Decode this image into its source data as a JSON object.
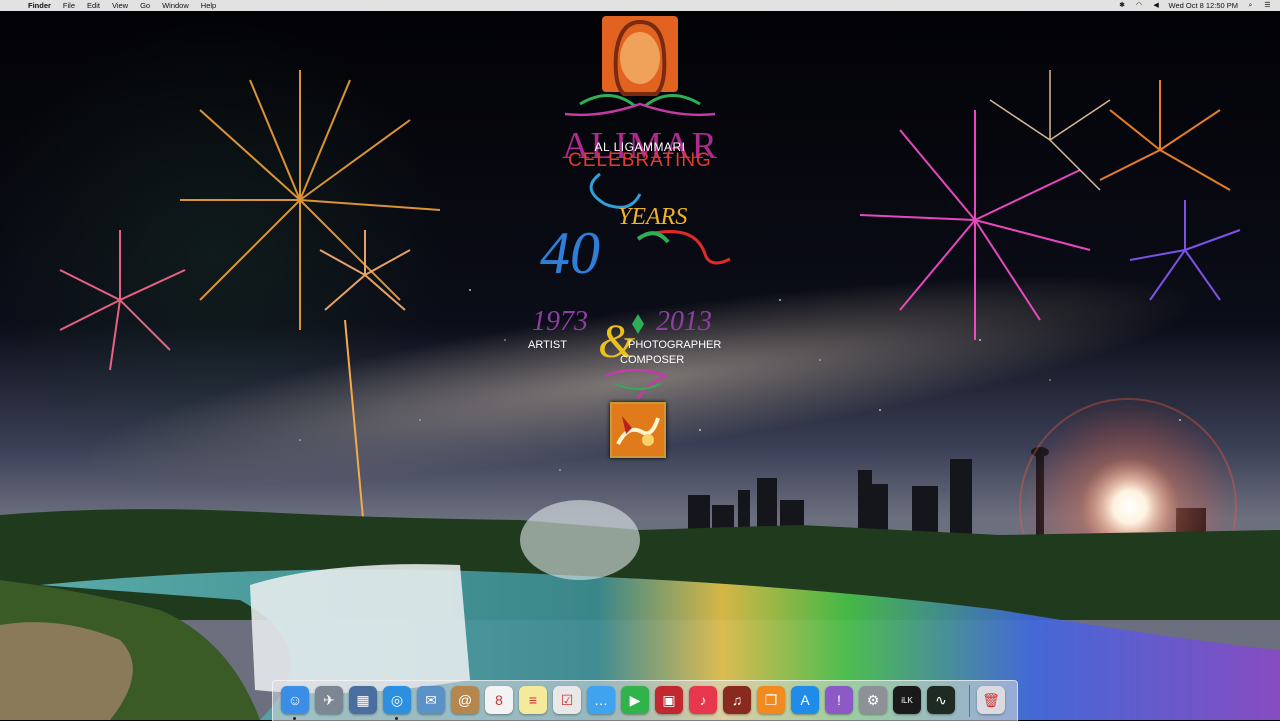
{
  "menubar": {
    "apple_icon": "apple-icon",
    "app_name": "Finder",
    "items": [
      "File",
      "Edit",
      "View",
      "Go",
      "Window",
      "Help"
    ],
    "status_icons": [
      "bluetooth-icon",
      "wifi-icon",
      "volume-icon"
    ],
    "clock": "Wed Oct 8  12:50 PM",
    "search_icon": "spotlight-search-icon",
    "list_icon": "notification-center-icon"
  },
  "logo": {
    "brand": "ALIMAR",
    "subname": "AL LIGAMMARI",
    "celebrating": "CELEBRATING",
    "years_big": "40",
    "years_word": "YEARS",
    "year_start": "1973",
    "year_end": "2013",
    "amp": "&",
    "artist": "ARTIST",
    "photographer": "PHOTOGRAPHER",
    "composer": "COMPOSER",
    "colors": {
      "brand": "#b02a8c",
      "celebrating": "#e33b2c",
      "forty": "#2e7fd8",
      "years": "#f1b329",
      "dates": "#8d3fa0"
    }
  },
  "dock": {
    "apps": [
      {
        "name": "finder-icon",
        "glyph": "☺",
        "color": "#3a8ee6",
        "running": true
      },
      {
        "name": "launchpad-icon",
        "glyph": "✈",
        "color": "#7d8794",
        "running": false
      },
      {
        "name": "mission-control-icon",
        "glyph": "▦",
        "color": "#4a6f9e",
        "running": false
      },
      {
        "name": "safari-icon",
        "glyph": "◎",
        "color": "#2d8fe0",
        "running": true
      },
      {
        "name": "mail-icon",
        "glyph": "✉",
        "color": "#5b92c6",
        "running": false
      },
      {
        "name": "contacts-icon",
        "glyph": "@",
        "color": "#b5874e",
        "running": false
      },
      {
        "name": "calendar-icon",
        "glyph": "8",
        "color": "#f3f3f3",
        "running": false
      },
      {
        "name": "notes-icon",
        "glyph": "≡",
        "color": "#f4ea9a",
        "running": false
      },
      {
        "name": "reminders-icon",
        "glyph": "☑",
        "color": "#e8e8e8",
        "running": false
      },
      {
        "name": "messages-icon",
        "glyph": "…",
        "color": "#3fa3f0",
        "running": false
      },
      {
        "name": "facetime-icon",
        "glyph": "▶",
        "color": "#2fb34a",
        "running": false
      },
      {
        "name": "photo-booth-icon",
        "glyph": "▣",
        "color": "#c2282f",
        "running": false
      },
      {
        "name": "itunes-icon",
        "glyph": "♪",
        "color": "#e6374c",
        "running": false
      },
      {
        "name": "garageband-icon",
        "glyph": "♫",
        "color": "#8a2a1e",
        "running": false
      },
      {
        "name": "ibooks-icon",
        "glyph": "❐",
        "color": "#f28a1f",
        "running": false
      },
      {
        "name": "app-store-icon",
        "glyph": "A",
        "color": "#1e8ce8",
        "running": false
      },
      {
        "name": "feedback-icon",
        "glyph": "!",
        "color": "#8c59c6",
        "running": false
      },
      {
        "name": "system-preferences-icon",
        "glyph": "⚙",
        "color": "#8e9298",
        "running": false
      },
      {
        "name": "ilok-icon",
        "glyph": "iLK",
        "color": "#1a1a1a",
        "running": false
      },
      {
        "name": "activity-monitor-icon",
        "glyph": "∿",
        "color": "#1e2a22",
        "running": false
      },
      {
        "name": "trash-icon",
        "glyph": "🗑",
        "color": "#d9dbe0",
        "running": false
      }
    ]
  }
}
